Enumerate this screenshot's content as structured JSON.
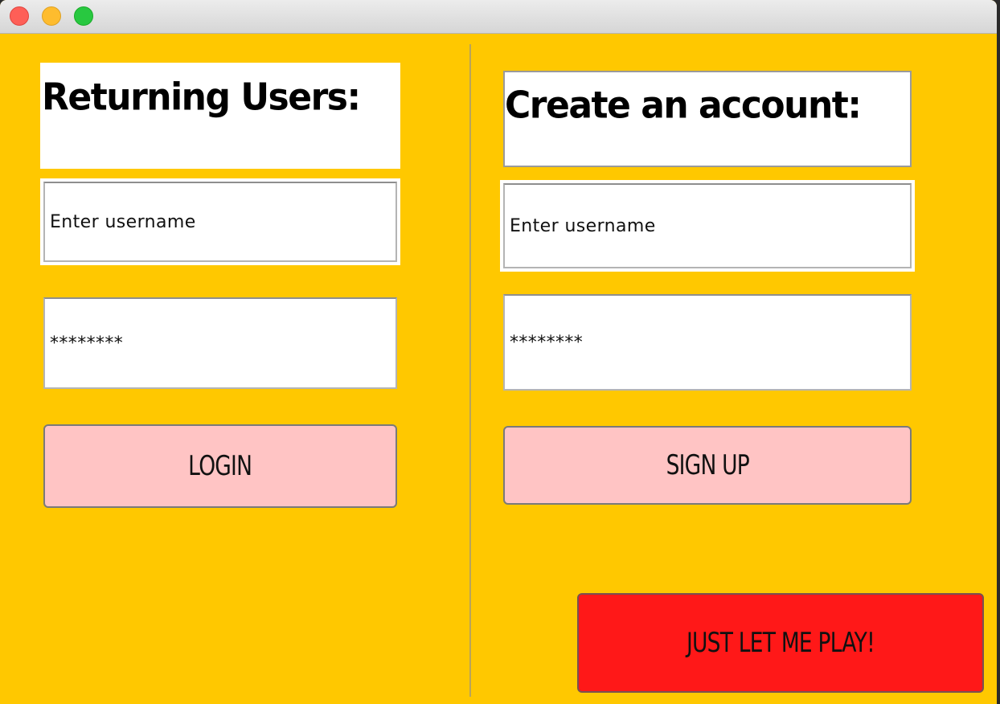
{
  "window": {
    "controls": [
      "close",
      "minimize",
      "maximize"
    ]
  },
  "returning": {
    "heading": "Returning Users:",
    "username_value": "Enter username",
    "password_value": "********",
    "login_label": "LOGIN"
  },
  "create": {
    "heading": "Create an account:",
    "username_value": "Enter username",
    "password_value": "********",
    "signup_label": "SIGN UP"
  },
  "play_label": "JUST LET ME PLAY!",
  "colors": {
    "background": "#FFC800",
    "button": "#FFC4C4",
    "play_button": "#FF1818",
    "field": "#FFFFFF"
  }
}
